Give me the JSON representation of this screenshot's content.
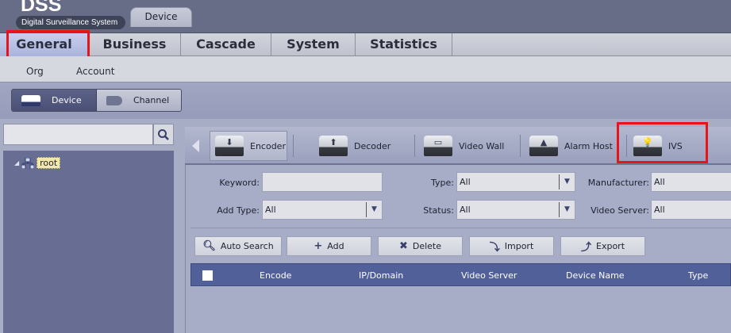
{
  "app": {
    "logo": "DSS",
    "subtitle": "Digital Surveillance System"
  },
  "top_tabs": [
    {
      "label": "General",
      "active": true
    },
    {
      "label": "Business"
    },
    {
      "label": "Cascade"
    },
    {
      "label": "System"
    },
    {
      "label": "Statistics"
    }
  ],
  "sub_tabs": [
    {
      "label": "Org"
    },
    {
      "label": "Account"
    },
    {
      "label": "Device",
      "active": true
    }
  ],
  "view_toggle": {
    "device": "Device",
    "channel": "Channel",
    "selected": "Device"
  },
  "tree": {
    "search_placeholder": "",
    "root": "root"
  },
  "device_types": [
    {
      "label": "Encoder",
      "icon": "encoder-icon",
      "selected": true
    },
    {
      "label": "Decoder",
      "icon": "decoder-icon"
    },
    {
      "label": "Video Wall",
      "icon": "video-wall-icon"
    },
    {
      "label": "Alarm Host",
      "icon": "alarm-host-icon"
    },
    {
      "label": "IVS",
      "icon": "ivs-icon"
    }
  ],
  "filters": {
    "keyword_label": "Keyword:",
    "keyword_value": "",
    "type_label": "Type:",
    "type_value": "All",
    "manufacturer_label": "Manufacturer:",
    "manufacturer_value": "All",
    "add_type_label": "Add Type:",
    "add_type_value": "All",
    "status_label": "Status:",
    "status_value": "All",
    "video_server_label": "Video Server:",
    "video_server_value": "All"
  },
  "actions": [
    "Auto Search",
    "Add",
    "Delete",
    "Import",
    "Export"
  ],
  "table": {
    "columns": [
      "Encode",
      "IP/Domain",
      "Video Server",
      "Device Name",
      "Type"
    ]
  },
  "colors": {
    "highlight": "#e8141c",
    "header": "#52609a"
  }
}
